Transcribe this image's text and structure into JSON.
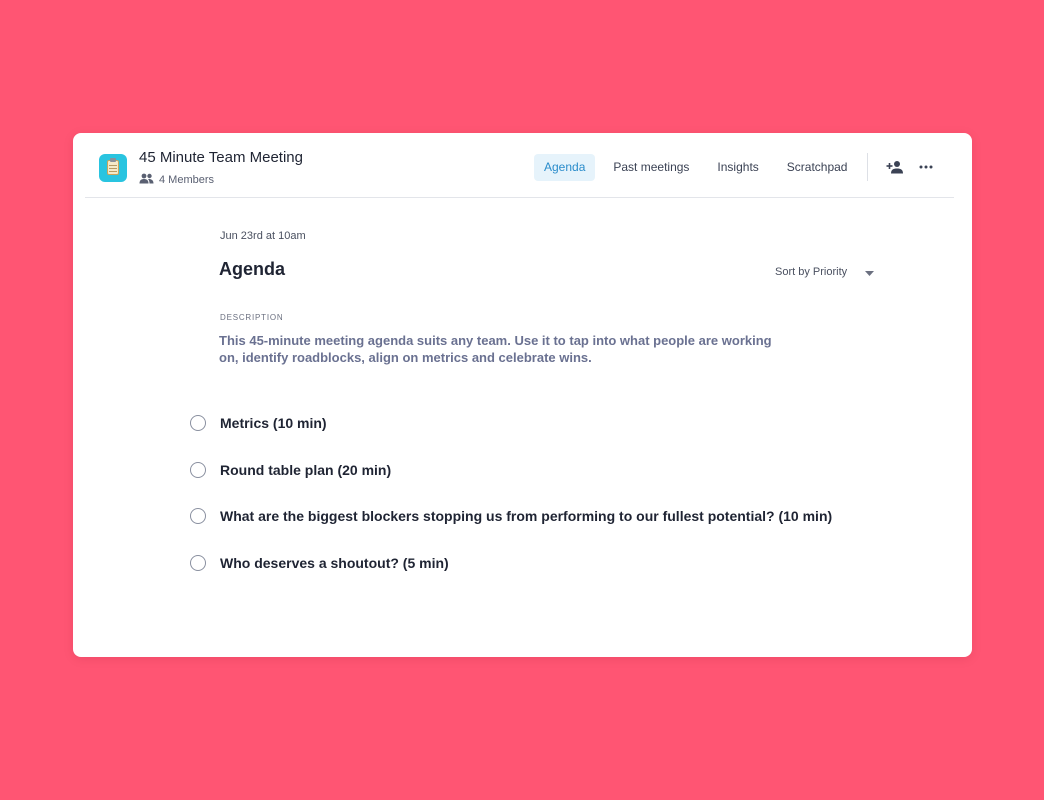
{
  "meeting": {
    "title": "45 Minute Team Meeting",
    "members_label": "4 Members",
    "icon": "clipboard-icon"
  },
  "tabs": [
    {
      "label": "Agenda",
      "active": true
    },
    {
      "label": "Past meetings",
      "active": false
    },
    {
      "label": "Insights",
      "active": false
    },
    {
      "label": "Scratchpad",
      "active": false
    }
  ],
  "header_actions": {
    "add_member_icon": "add-person-icon",
    "more_icon": "more-horizontal-icon"
  },
  "main": {
    "date": "Jun 23rd at 10am",
    "heading": "Agenda",
    "sort_label": "Sort by Priority",
    "description_label": "DESCRIPTION",
    "description": "This 45-minute meeting agenda suits any team. Use it to tap into what people are working on, identify roadblocks, align on metrics and celebrate wins."
  },
  "agenda_items": [
    {
      "text": "Metrics (10 min)",
      "checked": false
    },
    {
      "text": "Round table plan (20 min)",
      "checked": false
    },
    {
      "text": "What are the biggest blockers stopping us from performing to our fullest potential? (10 min)",
      "checked": false
    },
    {
      "text": "Who deserves a shoutout? (5 min)",
      "checked": false
    }
  ],
  "colors": {
    "background": "#ff5573",
    "accent": "#2a8ccb",
    "active_tab_bg": "#e6f3fb",
    "app_icon": "#29c4e0",
    "text_primary": "#1f2433",
    "text_muted": "#6a7191"
  }
}
